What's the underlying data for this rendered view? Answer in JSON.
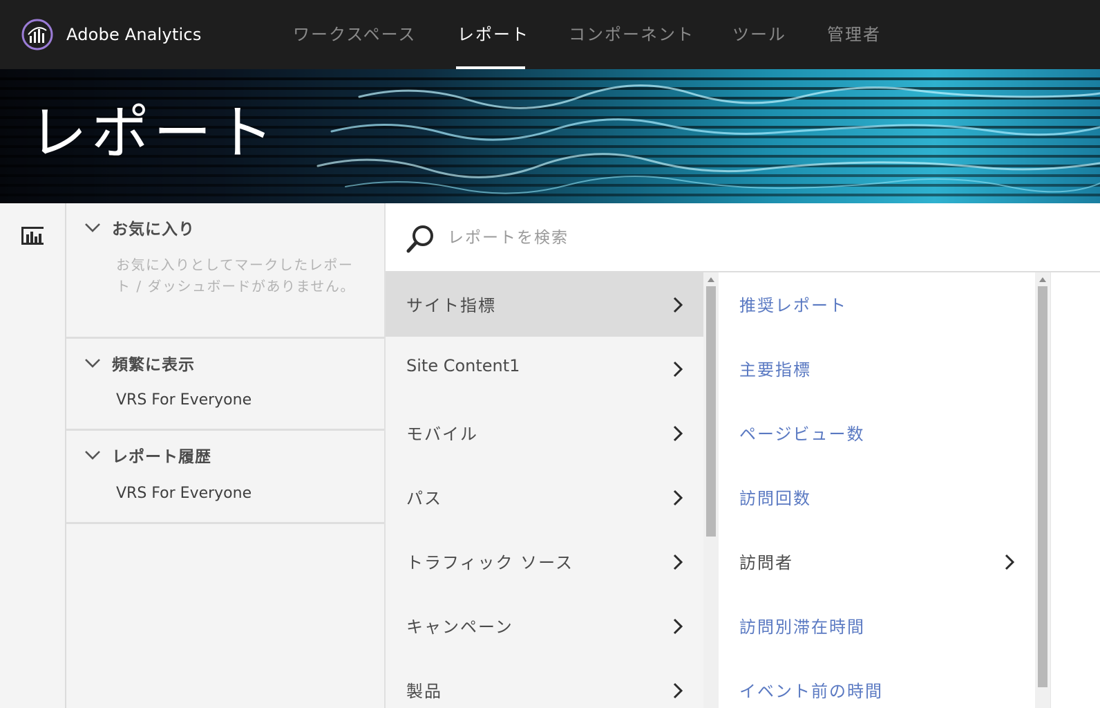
{
  "app": {
    "name": "Adobe Analytics",
    "logo_icon": "analytics-logo-icon"
  },
  "nav": {
    "items": [
      {
        "label": "ワークスペース"
      },
      {
        "label": "レポート",
        "active": true
      },
      {
        "label": "コンポーネント"
      },
      {
        "label": "ツール"
      },
      {
        "label": "管理者"
      }
    ]
  },
  "banner": {
    "title": "レポート"
  },
  "rail": {
    "icon": "bar-chart-icon"
  },
  "sections": {
    "favorites": {
      "title": "お気に入り",
      "empty_text": "お気に入りとしてマークしたレポート / ダッシュボードがありません。"
    },
    "frequent": {
      "title": "頻繁に表示",
      "item": "VRS For Everyone"
    },
    "history": {
      "title": "レポート履歴",
      "item": "VRS For Everyone"
    }
  },
  "search": {
    "placeholder": "レポートを検索",
    "value": ""
  },
  "categories": [
    {
      "label": "サイト指標",
      "selected": true
    },
    {
      "label": "Site Content1"
    },
    {
      "label": "モバイル"
    },
    {
      "label": "パス"
    },
    {
      "label": "トラフィック ソース"
    },
    {
      "label": "キャンペーン"
    },
    {
      "label": "製品"
    }
  ],
  "reports": [
    {
      "label": "推奨レポート"
    },
    {
      "label": "主要指標"
    },
    {
      "label": "ページビュー数"
    },
    {
      "label": "訪問回数"
    },
    {
      "label": "訪問者",
      "has_children": true
    },
    {
      "label": "訪問別滞在時間"
    },
    {
      "label": "イベント前の時間"
    }
  ],
  "colors": {
    "topbar": "#1e1e1e",
    "link": "#5a79c2",
    "selected_row": "#dcdcdc",
    "panel_bg": "#f4f4f4"
  }
}
